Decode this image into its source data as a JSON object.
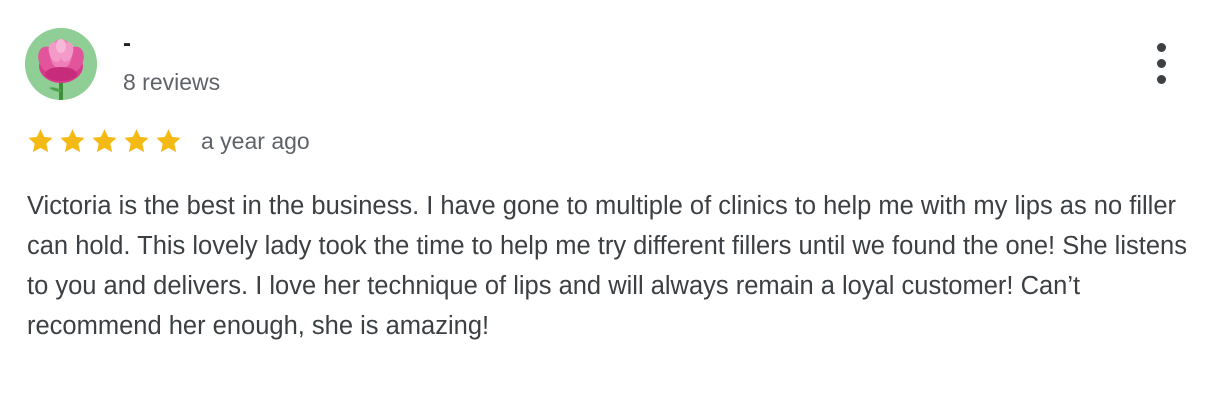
{
  "reviewer": {
    "name": "-",
    "review_count": "8 reviews",
    "avatar_icon": "pink-flower-icon",
    "avatar_bg": "#8fcf95"
  },
  "rating": {
    "stars": 5,
    "max_stars": 5,
    "star_color": "#f5b916",
    "time": "a year ago"
  },
  "review": {
    "text": "Victoria is the best in the business. I have gone to multiple of clinics to help me with my lips as no filler can hold. This lovely lady took the time to help me try different fillers until we found the one! She listens to you and delivers. I love her technique of lips and will always remain a loyal customer! Can’t recommend her enough, she is amazing!"
  },
  "menu": {
    "icon": "more-vertical-icon"
  }
}
